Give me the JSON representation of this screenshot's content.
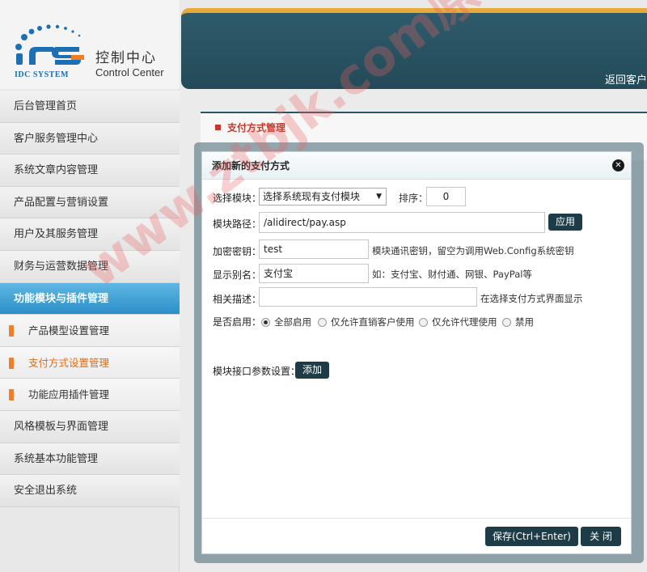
{
  "brand": {
    "logo_text": "IDC SYSTEM",
    "title_cn": "控制中心",
    "title_en": "Control Center"
  },
  "header": {
    "return_link": "返回客户"
  },
  "sidebar": {
    "items": [
      {
        "label": "后台管理首页"
      },
      {
        "label": "客户服务管理中心"
      },
      {
        "label": "系统文章内容管理"
      },
      {
        "label": "产品配置与营销设置"
      },
      {
        "label": "用户及其服务管理"
      },
      {
        "label": "财务与运营数据管理"
      },
      {
        "label": "功能模块与插件管理"
      },
      {
        "label": "产品模型设置管理"
      },
      {
        "label": "支付方式设置管理"
      },
      {
        "label": "功能应用插件管理"
      },
      {
        "label": "风格模板与界面管理"
      },
      {
        "label": "系统基本功能管理"
      },
      {
        "label": "安全退出系统"
      }
    ]
  },
  "panel": {
    "title": "支付方式管理"
  },
  "modal": {
    "title": "添加新的支付方式",
    "module_select_label": "选择模块：",
    "module_select_value": "选择系统现有支付模块",
    "order_label": "排序：",
    "order_value": "0",
    "path_label": "模块路径：",
    "path_value": "/alidirect/pay.asp",
    "apply_button": "应用",
    "key_label": "加密密钥：",
    "key_value": "test",
    "key_hint": "模块通讯密钥，留空为调用Web.Config系统密钥",
    "alias_label": "显示别名：",
    "alias_value": "支付宝",
    "alias_hint": "如：支付宝、财付通、网银、PayPal等",
    "desc_label": "相关描述：",
    "desc_value": "",
    "desc_hint": "在选择支付方式界面显示",
    "enable_label": "是否启用：",
    "enable_options": [
      "全部启用",
      "仅允许直销客户使用",
      "仅允许代理使用",
      "禁用"
    ],
    "params_label": "模块接口参数设置：",
    "add_button": "添加",
    "save_button": "保存(Ctrl+Enter)",
    "close_button": "关 闭"
  },
  "watermark": "www.ztbjk.com原创开发"
}
